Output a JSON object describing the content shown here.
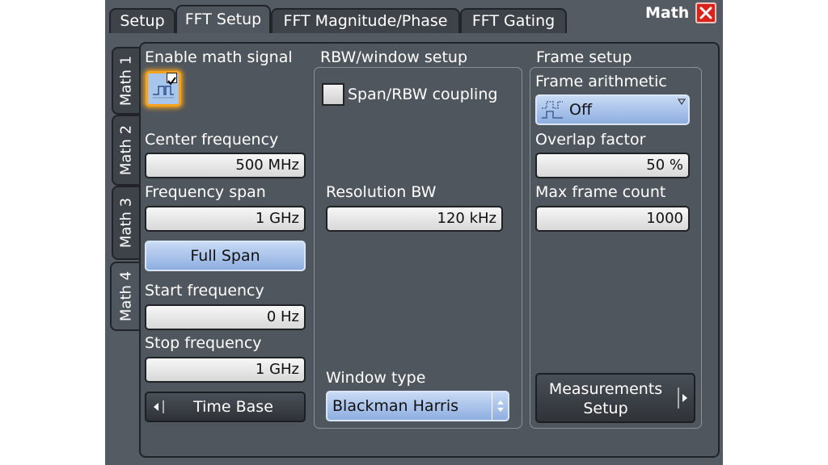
{
  "window": {
    "title": "Math",
    "close_icon": "close-icon"
  },
  "tabs": [
    {
      "label": "Setup",
      "active": false
    },
    {
      "label": "FFT Setup",
      "active": true
    },
    {
      "label": "FFT Magnitude/Phase",
      "active": false
    },
    {
      "label": "FFT Gating",
      "active": false
    }
  ],
  "side_tabs": [
    {
      "label": "Math 1",
      "active": false
    },
    {
      "label": "Math 2",
      "active": false
    },
    {
      "label": "Math 3",
      "active": false
    },
    {
      "label": "Math 4",
      "active": true
    }
  ],
  "left": {
    "enable_label": "Enable math signal",
    "enable_checked": true,
    "center_frequency_label": "Center frequency",
    "center_frequency_value": "500 MHz",
    "frequency_span_label": "Frequency span",
    "frequency_span_value": "1 GHz",
    "full_span_label": "Full Span",
    "start_frequency_label": "Start frequency",
    "start_frequency_value": "0 Hz",
    "stop_frequency_label": "Stop frequency",
    "stop_frequency_value": "1 GHz",
    "time_base_label": "Time Base"
  },
  "rbw": {
    "group_title": "RBW/window setup",
    "coupling_label": "Span/RBW coupling",
    "coupling_checked": false,
    "resolution_bw_label": "Resolution BW",
    "resolution_bw_value": "120 kHz",
    "window_type_label": "Window type",
    "window_type_value": "Blackman Harris"
  },
  "frame": {
    "group_title": "Frame setup",
    "frame_arithmetic_label": "Frame arithmetic",
    "frame_arithmetic_value": "Off",
    "overlap_factor_label": "Overlap factor",
    "overlap_factor_value": "50 %",
    "max_frame_count_label": "Max frame count",
    "max_frame_count_value": "1000",
    "measurements_setup_label": "Measurements Setup"
  },
  "colors": {
    "accent_glow": "#f5a21c",
    "background": "#555b62",
    "button_blue": "#a9c3ea",
    "close_red": "#d9231a"
  }
}
